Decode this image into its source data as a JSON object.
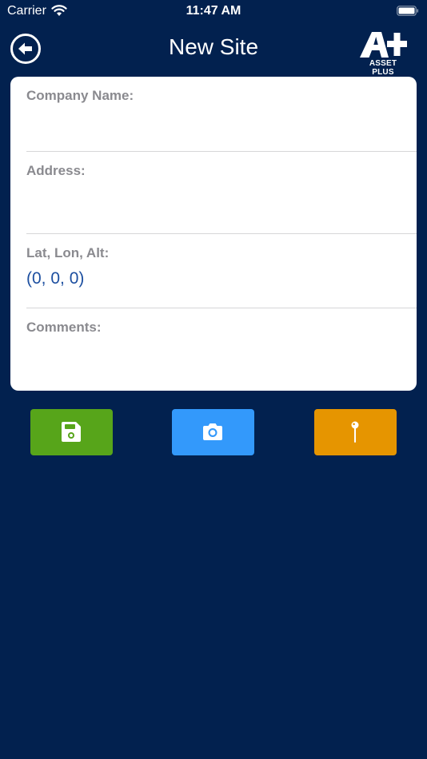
{
  "status_bar": {
    "carrier": "Carrier",
    "time": "11:47 AM"
  },
  "nav": {
    "title": "New Site",
    "logo_text": "ASSET PLUS"
  },
  "form": {
    "company_name": {
      "label": "Company Name:",
      "value": ""
    },
    "address": {
      "label": "Address:",
      "value": ""
    },
    "location": {
      "label": "Lat, Lon, Alt:",
      "value": "(0, 0, 0)"
    },
    "comments": {
      "label": "Comments:",
      "value": ""
    }
  },
  "actions": [
    {
      "icon": "save-icon",
      "color": "#57a51a"
    },
    {
      "icon": "camera-icon",
      "color": "#3399fb"
    },
    {
      "icon": "pin-icon",
      "color": "#e69500"
    }
  ],
  "colors": {
    "background": "#02214f",
    "card": "#ffffff",
    "label": "#8a8a8f",
    "value": "#1d4fa0"
  }
}
